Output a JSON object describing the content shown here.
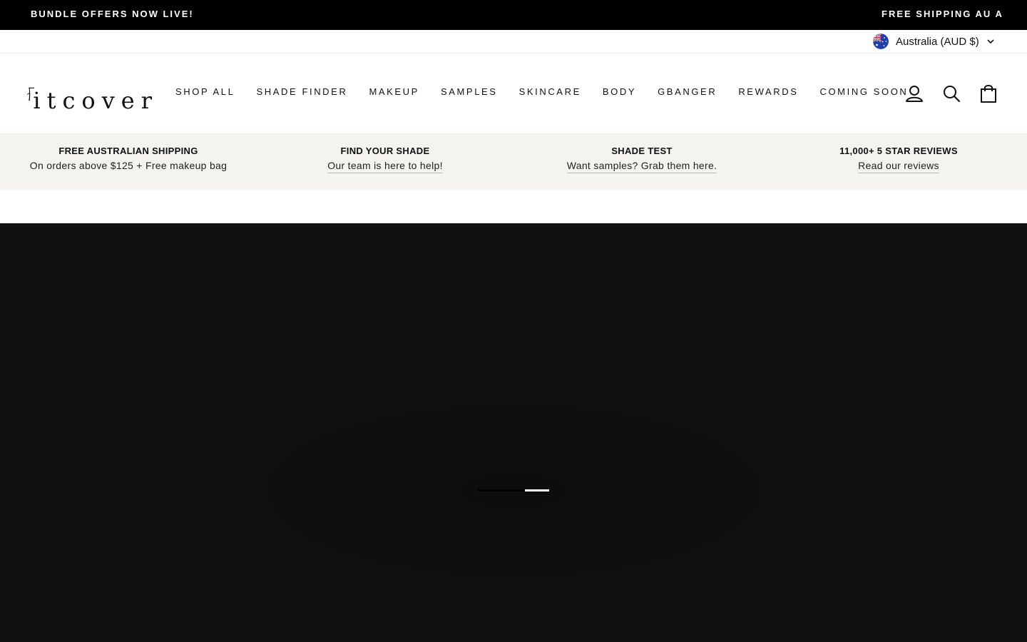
{
  "announcement": {
    "left_text": "BUNDLE OFFERS NOW LIVE!",
    "right_text": "FREE SHIPPING AU A"
  },
  "locale": {
    "label": "Australia (AUD $)",
    "flag_icon": "australia-flag-icon",
    "dropdown_icon": "chevron-down-icon"
  },
  "brand": {
    "logo_text": "itcover"
  },
  "nav": {
    "items": [
      {
        "label": "SHOP ALL"
      },
      {
        "label": "SHADE FINDER"
      },
      {
        "label": "MAKEUP"
      },
      {
        "label": "SAMPLES"
      },
      {
        "label": "SKINCARE"
      },
      {
        "label": "BODY"
      },
      {
        "label": "GBANGER"
      },
      {
        "label": "REWARDS"
      },
      {
        "label": "COMING SOON"
      }
    ]
  },
  "header_icons": {
    "account": "account-icon",
    "search": "search-icon",
    "cart": "cart-icon"
  },
  "features": [
    {
      "title": "FREE AUSTRALIAN SHIPPING",
      "subtitle": "On orders above $125 + Free makeup bag"
    },
    {
      "title": "FIND YOUR SHADE",
      "subtitle": "Our team is here to help!"
    },
    {
      "title": "SHADE TEST",
      "subtitle": "Want samples? Grab them here."
    },
    {
      "title": "11,000+ 5 STAR REVIEWS",
      "subtitle": "Read our reviews"
    }
  ],
  "hero": {
    "slide_count": 2,
    "active_slide": 2
  },
  "colors": {
    "announcement_bg": "#000000",
    "feature_bar_bg": "#f4f3ef",
    "hero_bg": "#111111",
    "text": "#111111"
  }
}
